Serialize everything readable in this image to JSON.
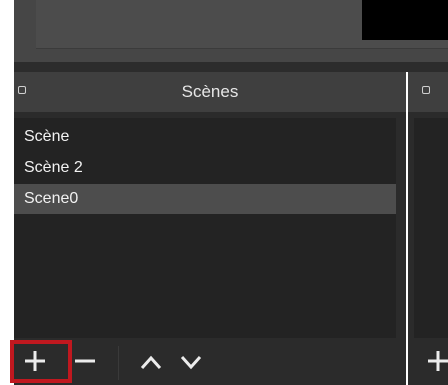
{
  "scenes_dock": {
    "title": "Scènes",
    "items": [
      {
        "label": "Scène",
        "selected": false
      },
      {
        "label": "Scène 2",
        "selected": false
      },
      {
        "label": "Scene0",
        "selected": true
      }
    ],
    "toolbar": {
      "add_icon": "plus-icon",
      "remove_icon": "minus-icon",
      "move_up_icon": "chevron-up-icon",
      "move_down_icon": "chevron-down-icon"
    }
  },
  "colors": {
    "highlight": "#c0181f",
    "dock_bg": "#2b2b2b",
    "title_bg": "#3f3f3f",
    "selected_bg": "#4d4d4d"
  }
}
